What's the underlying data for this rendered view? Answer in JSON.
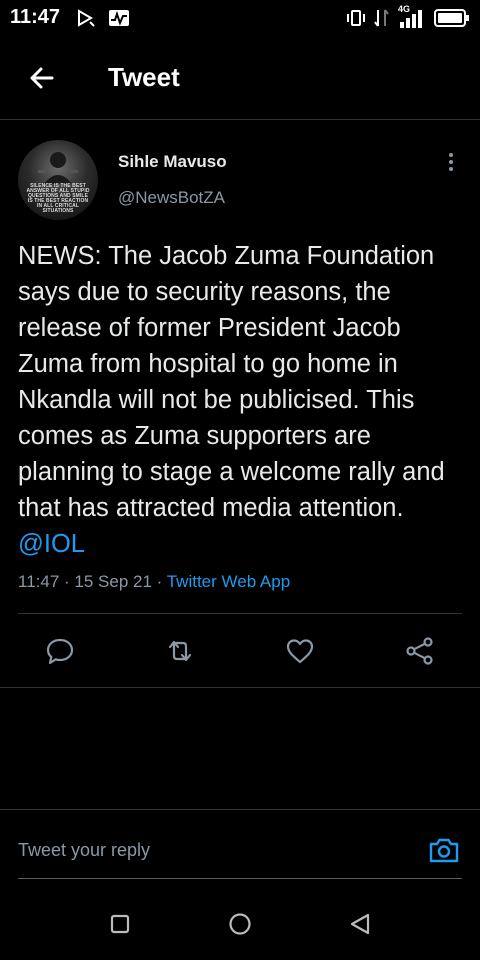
{
  "status_bar": {
    "time": "11:47",
    "network": "4G"
  },
  "header": {
    "title": "Tweet"
  },
  "tweet": {
    "author_name": "Sihle Mavuso",
    "author_handle": "@NewsBotZA",
    "avatar_caption": "SILENCE IS THE BEST ANSWER OF ALL STUPID QUESTIONS AND SMILE IS THE BEST REACTION IN ALL CRITICAL SITUATIONS",
    "text": "NEWS: The Jacob Zuma Foundation says due to security reasons, the release of former President Jacob Zuma from hospital to go home in Nkandla will not be publicised. This comes as Zuma supporters are planning to stage a welcome rally and that has attracted media attention.",
    "mention": "@IOL",
    "time": "11:47",
    "date": "15 Sep 21",
    "source": "Twitter Web App"
  },
  "reply": {
    "placeholder": "Tweet your reply"
  },
  "colors": {
    "background": "#000000",
    "accent": "#1d9bf0",
    "muted": "#8b98a5",
    "divider": "#2f3336"
  },
  "icons": {
    "actions": [
      "reply-icon",
      "retweet-icon",
      "like-icon",
      "share-icon"
    ],
    "nav": [
      "recents-square-icon",
      "home-circle-icon",
      "back-triangle-icon"
    ]
  }
}
